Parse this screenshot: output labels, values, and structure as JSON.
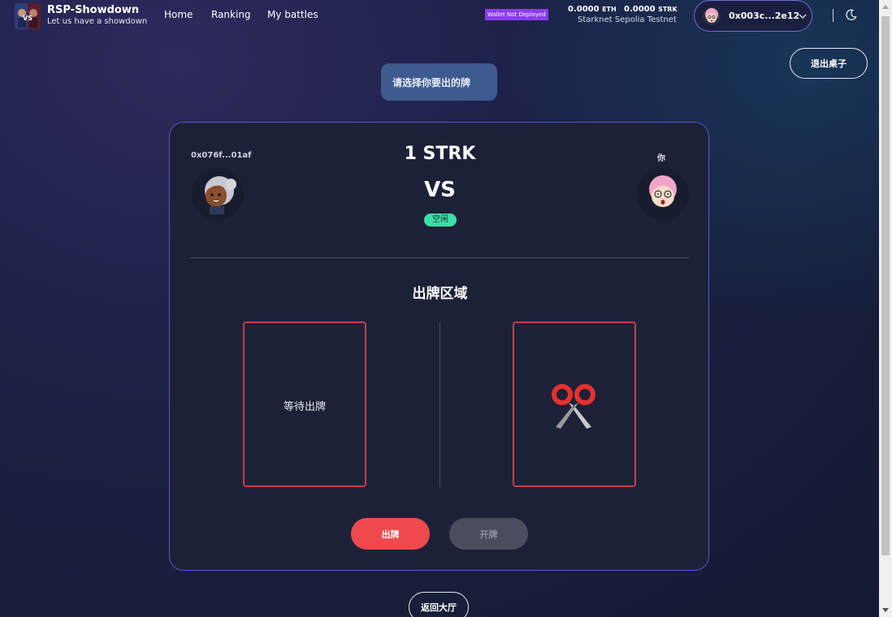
{
  "header": {
    "brand_title": "RSP-Showdown",
    "brand_subtitle": "Let us have a showdown",
    "nav": [
      "Home",
      "Ranking",
      "My battles"
    ],
    "wallet_badge": "Wallet Not Deployed",
    "eth_balance": "0.0000",
    "eth_unit": "ETH",
    "strk_balance": "0.0000",
    "strk_unit": "STRK",
    "network": "Starknet Sepolia Testnet",
    "account_address": "0x003c...2e12",
    "icons": [
      "chevron-down-icon",
      "moon-icon"
    ]
  },
  "actions": {
    "exit_table": "退出桌子",
    "back_to_lobby": "返回大厅"
  },
  "prompt": "请选择你要出的牌",
  "game": {
    "opponent_address": "0x076f...01af",
    "you_label": "你",
    "stake": "1 STRK",
    "vs": "VS",
    "status": "空闲",
    "area_title": "出牌区域",
    "opponent_slot_text": "等待出牌",
    "my_card_icon": "scissors-icon",
    "play_button": "出牌",
    "reveal_button": "开牌"
  },
  "colors": {
    "accent_border": "#5b56cc",
    "play_red": "#ee4a4e",
    "status_green": "#3ddfa8",
    "badge_purple": "#8b3cf0"
  }
}
